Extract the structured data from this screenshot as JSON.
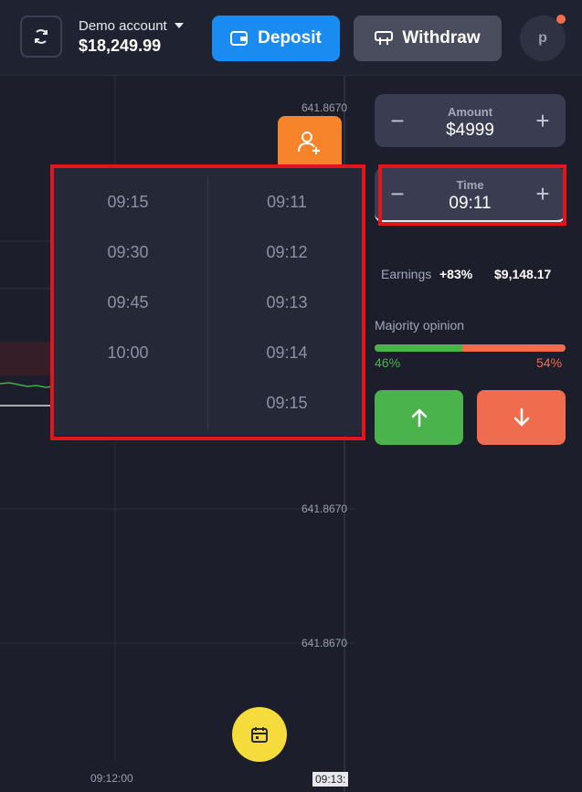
{
  "header": {
    "account_label": "Demo account",
    "balance": "$18,249.99",
    "deposit_label": "Deposit",
    "withdraw_label": "Withdraw",
    "avatar_initial": "p"
  },
  "chart": {
    "price_labels": [
      "641.8670",
      "641.8670",
      "641.8670"
    ],
    "time_labels": [
      "09:12:00",
      "09:13:"
    ]
  },
  "trade": {
    "amount": {
      "label": "Amount",
      "value": "$4999"
    },
    "time": {
      "label": "Time",
      "value": "09:11"
    },
    "earnings": {
      "label": "Earnings",
      "percent": "+83%",
      "amount": "$9,148.17"
    },
    "majority": {
      "label": "Majority opinion",
      "up_percent": "46%",
      "down_percent": "54%",
      "up_fraction": 0.46
    }
  },
  "time_dropdown": {
    "left_options": [
      "09:15",
      "09:30",
      "09:45",
      "10:00"
    ],
    "right_options": [
      "09:11",
      "09:12",
      "09:13",
      "09:14",
      "09:15"
    ]
  },
  "colors": {
    "accent": "#1a8cf1",
    "up": "#4ab34b",
    "down": "#ef6c4f",
    "highlight": "#e2151c",
    "invite": "#f7842a",
    "calendar": "#f6db3c"
  },
  "icons": {
    "switch": "swap-arrows-icon",
    "deposit": "wallet-icon",
    "withdraw": "withdraw-icon",
    "invite": "user-plus-icon",
    "calendar": "calendar-icon",
    "up": "arrow-up-icon",
    "down": "arrow-down-icon"
  }
}
